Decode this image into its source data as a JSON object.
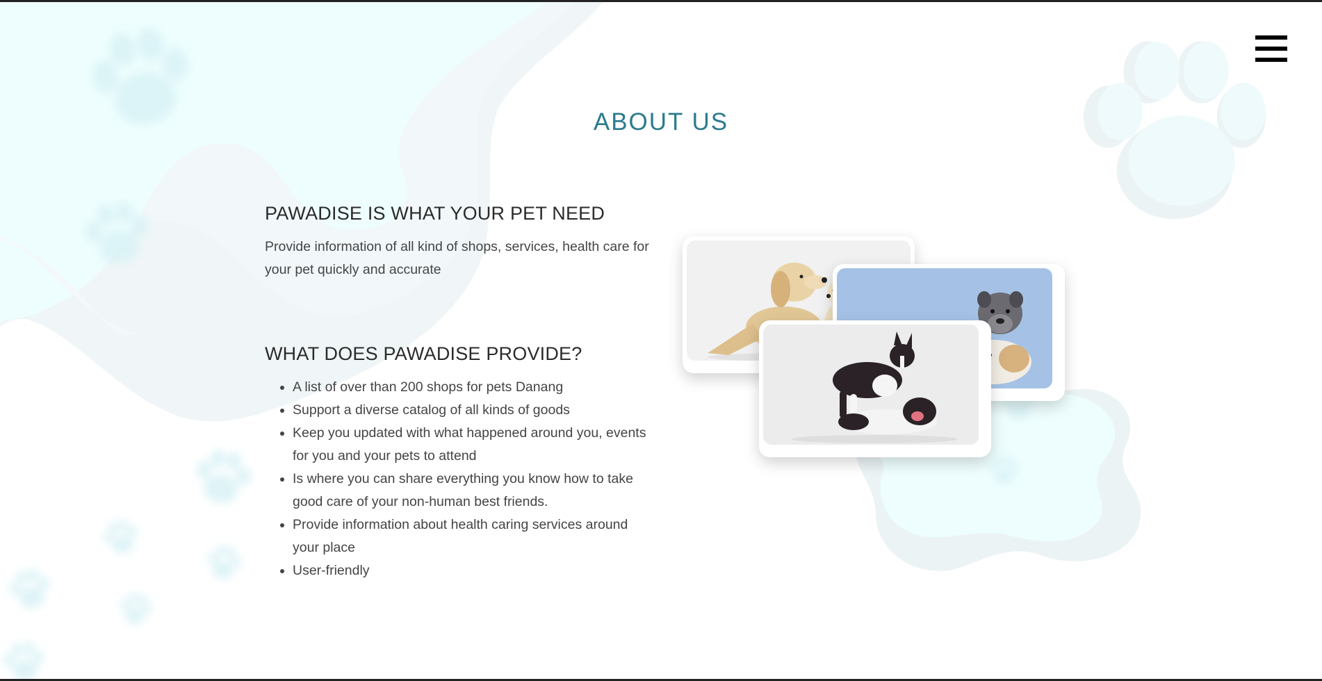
{
  "page": {
    "title": "ABOUT US"
  },
  "header": {
    "menu_icon": "hamburger-menu-icon"
  },
  "about": {
    "heading": "PAWADISE IS WHAT YOUR PET NEED",
    "text": "Provide information of all kind of shops, services, health care for your pet quickly and accurate"
  },
  "provide": {
    "heading": "WHAT DOES PAWADISE PROVIDE?",
    "items": [
      "A list of over than 200 shops for pets Danang",
      "Support a diverse catalog of all kinds of goods",
      "Keep you updated with what happened around you, events for you and your pets to attend",
      "Is where you can share everything you know how to take good care of your non-human best friends.",
      "Provide information about health caring services around your place",
      "User-friendly"
    ]
  },
  "images": [
    {
      "subject": "golden-retriever-and-puppy"
    },
    {
      "subject": "bulldogs-on-blue"
    },
    {
      "subject": "boston-terriers-playing"
    }
  ],
  "colors": {
    "title": "#2c7b8d",
    "title_dark": "#1a5566",
    "blob_light": "#eefefe",
    "blob_shadow": "#e3f0f2",
    "paw": "#d6f3f7"
  }
}
